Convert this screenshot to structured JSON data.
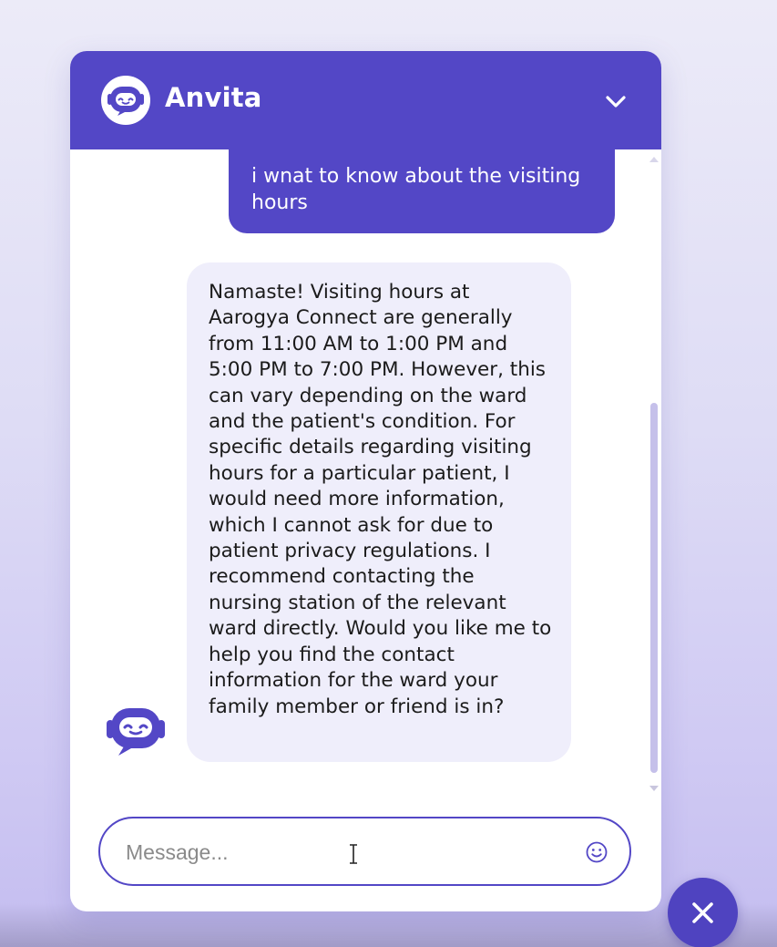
{
  "header": {
    "title": "Anvita",
    "avatar_icon": "robot-icon",
    "collapse_icon": "chevron-down-icon"
  },
  "messages": [
    {
      "sender": "user",
      "text": "i wnat to know about the visiting hours"
    },
    {
      "sender": "bot",
      "text": "Namaste! Visiting hours at Aarogya Connect are generally from 11:00 AM to 1:00 PM and 5:00 PM to 7:00 PM. However, this can vary depending on the ward and the patient's condition. For specific details regarding visiting hours for a particular patient, I would need more information, which I cannot ask for due to patient privacy regulations. I recommend contacting the nursing station of the relevant ward directly. Would you like me to help you find the contact information for the ward your family member or friend is in?"
    }
  ],
  "composer": {
    "placeholder": "Message...",
    "value": "",
    "emoji_icon": "smiley-icon"
  },
  "launcher": {
    "close_icon": "close-icon"
  },
  "colors": {
    "brand": "#5347c6",
    "bot_bubble": "#efeefb",
    "scroll_thumb": "#c5c0ea"
  }
}
